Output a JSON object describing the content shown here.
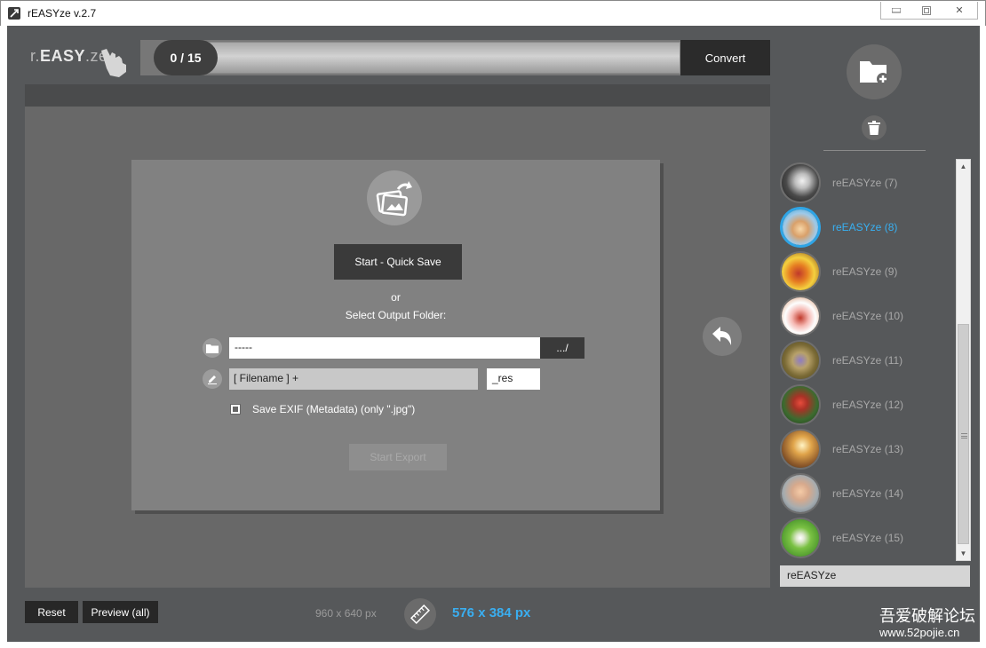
{
  "window": {
    "title": "rEASYze v.2.7",
    "controls": {
      "minimize": "▭",
      "maximize": "▢",
      "close": "✕"
    }
  },
  "header": {
    "logo": {
      "prefix": "r.",
      "bold": "EASY",
      "suffix": ".ze"
    },
    "progress": {
      "label": "0 / 15",
      "fraction": 0.0
    },
    "convert_label": "Convert"
  },
  "export_panel": {
    "icon": "image-export-icon",
    "quick_save_label": "Start - Quick Save",
    "or_text": "or",
    "select_text": "Select Output Folder:",
    "folder_value": "-----",
    "browse_label": ".../",
    "filename_value": "[ Filename ] +",
    "suffix_value": "_res",
    "exif_label": "Save EXIF (Metadata) (only \".jpg\")",
    "exif_checked": true,
    "start_export_label": "Start Export"
  },
  "sidebar": {
    "items": [
      {
        "label": "reEASYze (7)",
        "active": false
      },
      {
        "label": "reEASYze (8)",
        "active": true
      },
      {
        "label": "reEASYze (9)",
        "active": false
      },
      {
        "label": "reEASYze (10)",
        "active": false
      },
      {
        "label": "reEASYze (11)",
        "active": false
      },
      {
        "label": "reEASYze (12)",
        "active": false
      },
      {
        "label": "reEASYze (13)",
        "active": false
      },
      {
        "label": "reEASYze (14)",
        "active": false
      },
      {
        "label": "reEASYze (15)",
        "active": false
      }
    ],
    "name_value": "reEASYze"
  },
  "bottom": {
    "reset_label": "Reset",
    "preview_label": "Preview (all)",
    "original_size": "960 x 640 px",
    "new_size": "576 x 384 px"
  },
  "watermark": {
    "line1": "吾爱破解论坛",
    "line2": "www.52pojie.cn"
  },
  "colors": {
    "accent": "#2fa5e6",
    "background": "#56585a",
    "canvas": "#686868",
    "panel": "#818181"
  }
}
